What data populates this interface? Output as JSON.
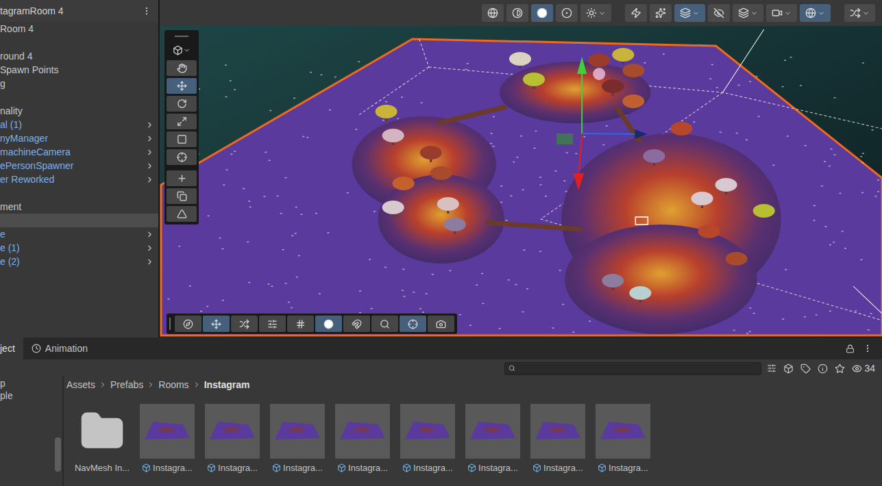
{
  "hierarchy": {
    "title": "tagramRoom 4",
    "items": [
      {
        "label": "Room 4",
        "prefab": false,
        "expandable": false,
        "selected": false
      },
      {
        "label": "",
        "prefab": false,
        "expandable": false,
        "selected": false
      },
      {
        "label": "round 4",
        "prefab": false,
        "expandable": false,
        "selected": false
      },
      {
        "label": "Spawn Points",
        "prefab": false,
        "expandable": false,
        "selected": false
      },
      {
        "label": "g",
        "prefab": false,
        "expandable": false,
        "selected": false
      },
      {
        "label": "",
        "prefab": false,
        "expandable": false,
        "selected": false
      },
      {
        "label": "nality",
        "prefab": false,
        "expandable": false,
        "selected": false
      },
      {
        "label": "al (1)",
        "prefab": true,
        "expandable": true,
        "selected": false
      },
      {
        "label": "nyManager",
        "prefab": true,
        "expandable": true,
        "selected": false
      },
      {
        "label": "machineCamera",
        "prefab": true,
        "expandable": true,
        "selected": false
      },
      {
        "label": "ePersonSpawner",
        "prefab": true,
        "expandable": true,
        "selected": false
      },
      {
        "label": "er Reworked",
        "prefab": true,
        "expandable": true,
        "selected": false
      },
      {
        "label": "",
        "prefab": false,
        "expandable": false,
        "selected": false
      },
      {
        "label": "ment",
        "prefab": false,
        "expandable": false,
        "selected": false
      },
      {
        "label": "",
        "prefab": false,
        "expandable": false,
        "selected": true
      },
      {
        "label": "e",
        "prefab": true,
        "expandable": true,
        "selected": false
      },
      {
        "label": "e (1)",
        "prefab": true,
        "expandable": true,
        "selected": false
      },
      {
        "label": "e (2)",
        "prefab": true,
        "expandable": true,
        "selected": false
      }
    ]
  },
  "scene": {
    "top_toolbar": [
      {
        "selected": false
      },
      {
        "selected": false
      },
      {
        "selected": true
      },
      {
        "selected": false
      },
      {
        "selected": false
      },
      {
        "selected": false
      },
      {
        "selected": false
      },
      {
        "selected": true
      },
      {
        "selected": false
      },
      {
        "selected": false
      },
      {
        "selected": false
      },
      {
        "selected": true
      },
      {
        "selected": false
      }
    ],
    "tools": [
      {
        "selected": false
      },
      {
        "selected": true
      },
      {
        "selected": false
      },
      {
        "selected": false
      },
      {
        "selected": false
      },
      {
        "selected": false
      },
      {
        "selected": false
      },
      {
        "selected": false
      },
      {
        "selected": false
      }
    ],
    "overlay_toolbar": [
      {
        "selected": false
      },
      {
        "selected": true
      },
      {
        "selected": false
      },
      {
        "selected": false
      },
      {
        "selected": false
      },
      {
        "selected": true
      },
      {
        "selected": false
      },
      {
        "selected": false
      },
      {
        "selected": true
      },
      {
        "selected": false
      }
    ]
  },
  "project": {
    "tabs": [
      {
        "label": "ject",
        "selected": true
      },
      {
        "label": "Animation",
        "selected": false
      }
    ],
    "count": "34",
    "tree": [
      "p",
      "ple"
    ],
    "breadcrumb": [
      "Assets",
      "Prefabs",
      "Rooms",
      "Instagram"
    ],
    "assets": [
      {
        "label": "NavMesh In...",
        "kind": "folder"
      },
      {
        "label": "Instagra...",
        "kind": "prefab"
      },
      {
        "label": "Instagra...",
        "kind": "prefab"
      },
      {
        "label": "Instagra...",
        "kind": "prefab"
      },
      {
        "label": "Instagra...",
        "kind": "prefab"
      },
      {
        "label": "Instagra...",
        "kind": "prefab"
      },
      {
        "label": "Instagra...",
        "kind": "prefab"
      },
      {
        "label": "Instagra...",
        "kind": "prefab"
      },
      {
        "label": "Instagra...",
        "kind": "prefab"
      }
    ]
  }
}
